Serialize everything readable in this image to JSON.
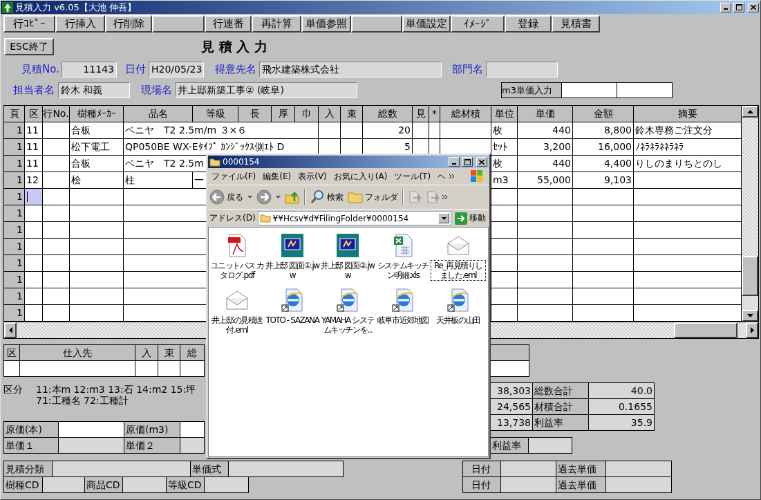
{
  "window": {
    "title": "見積入力 v6.05【大池 伸吾】"
  },
  "toolbar": [
    {
      "kind": "button",
      "label": "行ｺﾋﾟｰ"
    },
    {
      "kind": "button",
      "label": "行挿入"
    },
    {
      "kind": "button",
      "label": "行削除"
    },
    {
      "kind": "blank"
    },
    {
      "kind": "button",
      "label": "行連番"
    },
    {
      "kind": "button",
      "label": "再計算"
    },
    {
      "kind": "button",
      "label": "単価参照"
    },
    {
      "kind": "blank"
    },
    {
      "kind": "button",
      "label": "単価設定"
    },
    {
      "kind": "button",
      "label": "ｲﾒｰｼﾞ"
    },
    {
      "kind": "button",
      "label": "登録"
    },
    {
      "kind": "button",
      "label": "見積書"
    }
  ],
  "header": {
    "exit_button": "ESC終了",
    "title": "見 積 入 力",
    "field_rows": [
      [
        {
          "label": "見積No.",
          "value": "11143"
        },
        {
          "label": "日付",
          "value": "H20/05/23"
        },
        {
          "label": "得意先名",
          "value": "飛水建築株式会社"
        },
        {
          "label": "部門名"
        }
      ],
      [
        {
          "label": "担当者名",
          "value": "鈴木 和義"
        },
        {
          "label": "現場名",
          "value": "井上邸新築工事② (岐阜)"
        }
      ]
    ],
    "m3_price_input": {
      "label": "m3単価入力"
    }
  },
  "table": {
    "columns": [
      "頁",
      "区",
      "行No.",
      "樹種ﾒｰｶｰ",
      "品名",
      "等級",
      "長",
      "厚",
      "巾",
      "入",
      "束",
      "総数",
      "見",
      "*",
      "総材積",
      "単位",
      "単価",
      "金額",
      "摘要"
    ],
    "rows": [
      {
        "page": "1",
        "section": "11",
        "maker": "合板",
        "product": "ベニヤ　T2 2.5m/m ３×６",
        "quantity": "20",
        "unit": "枚",
        "unit_price": "440",
        "amount": "8,800",
        "note": "鈴木専務ご注文分",
        "selected": false
      },
      {
        "page": "1",
        "section": "11",
        "maker": "松下電工",
        "product": "QP050BE WX-Eﾀｲﾌﾟ ｶﾝｼﾞｯｸｽ側ｴﾄ D",
        "quantity": "5",
        "unit": "ｾｯﾄ",
        "unit_price": "3,200",
        "amount": "16,000",
        "note": "ﾉﾈﾗﾈﾗﾈﾈﾗﾈﾗ",
        "selected": false
      },
      {
        "page": "1",
        "section": "11",
        "maker": "合板",
        "product": "ベニヤ　T2 2.5m",
        "unit": "枚",
        "unit_price": "440",
        "amount": "4,400",
        "note": "りしのまりちとのし",
        "selected": false
      },
      {
        "page": "1",
        "section": "12",
        "maker": "桧",
        "product": "柱",
        "grade": "一",
        "unit": "m3",
        "unit_price": "55,000",
        "amount": "9,103",
        "selected": false
      },
      {
        "page": "1",
        "selected": true
      },
      {
        "page": "1",
        "selected": false
      },
      {
        "page": "1",
        "selected": false
      },
      {
        "page": "1",
        "selected": false
      },
      {
        "page": "1",
        "selected": false
      },
      {
        "page": "1",
        "selected": false
      },
      {
        "page": "1",
        "selected": false
      },
      {
        "page": "1",
        "selected": false
      }
    ]
  },
  "bottom": {
    "supplier_columns": [
      "区",
      "仕入先",
      "入",
      "束",
      "総"
    ],
    "legend": {
      "label": "区分",
      "lines": [
        "11:本m 12:m3 13:石 14:m2 15:坪",
        "71:工種名 72:工種計"
      ]
    },
    "cost_fields": [
      {
        "label": "原価(本)",
        "editable": true
      },
      {
        "label": "原価(m3)",
        "editable": true
      },
      {
        "label": "単価１",
        "editable": false
      },
      {
        "label": "単価２",
        "editable": false
      }
    ],
    "totals": [
      {
        "amount": "38,303",
        "label": "総数合計",
        "value": "40.0"
      },
      {
        "amount": "24,565",
        "label": "材積合計",
        "value": "0.1655"
      },
      {
        "amount": "13,738",
        "label": "利益率",
        "value": "35.9"
      }
    ],
    "profit_rate": {
      "label": "利益率"
    },
    "code_rows": [
      [
        {
          "label": "見積分類"
        },
        {
          "label": "単価式"
        }
      ],
      [
        {
          "label": "樹種CD"
        },
        {
          "label": "商品CD"
        },
        {
          "label": "等級CD"
        }
      ]
    ],
    "history_rows": [
      {
        "date_label": "日付",
        "price_label": "過去単価"
      },
      {
        "date_label": "日付",
        "price_label": "過去単価"
      }
    ]
  },
  "explorer": {
    "title": "0000154",
    "menu": [
      "ファイル(F)",
      "編集(E)",
      "表示(V)",
      "お気に入り(A)",
      "ツール(T)",
      "ヘ"
    ],
    "back": "戻る",
    "search": "検索",
    "folders": "フォルダ",
    "address_label": "アドレス(D)",
    "address": "¥¥Hcsv¥d¥FilingFolder¥0000154",
    "go": "移動",
    "items": [
      {
        "kind": "pdf",
        "label": "ユニットバス カタログ.pdf",
        "selected": false
      },
      {
        "kind": "jww",
        "label": "井上邸 図面①.jww",
        "selected": false
      },
      {
        "kind": "jww",
        "label": "井上邸 図面②.jww",
        "selected": false
      },
      {
        "kind": "xls",
        "label": "システムキッチン明細.xls",
        "selected": false
      },
      {
        "kind": "eml",
        "label": "Re_再見積りしました.eml",
        "selected": true
      },
      {
        "kind": "eml",
        "label": "井上邸の見積送付.eml",
        "selected": false
      },
      {
        "kind": "url",
        "label": "TOTO - SAZANA",
        "selected": false
      },
      {
        "kind": "url",
        "label": "YAMAHA システムキッチンを...",
        "selected": false
      },
      {
        "kind": "url",
        "label": "岐阜市近郊地図",
        "selected": false
      },
      {
        "kind": "url",
        "label": "天井板の山田",
        "selected": false
      }
    ]
  }
}
